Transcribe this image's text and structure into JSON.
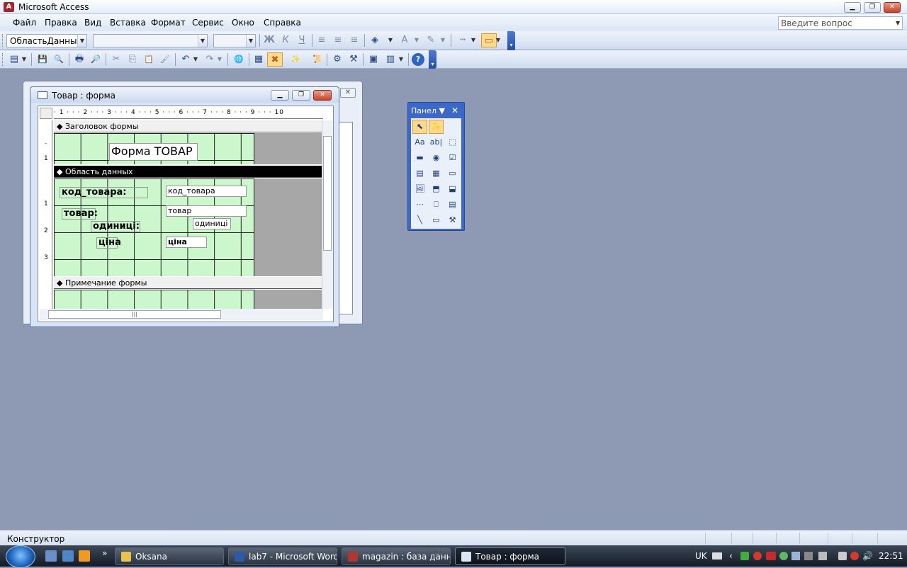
{
  "app": {
    "title": "Microsoft Access",
    "icon_letter": "A"
  },
  "window_controls": {
    "minimize": "▁",
    "restore": "❐",
    "close": "✕"
  },
  "menu": [
    "Файл",
    "Правка",
    "Вид",
    "Вставка",
    "Формат",
    "Сервис",
    "Окно",
    "Справка"
  ],
  "help_search_placeholder": "Введите вопрос",
  "formatting_toolbar": {
    "object_combo": "ОбластьДанных",
    "font_combo": "",
    "size_combo": "",
    "bold": "Ж",
    "italic": "К",
    "underline": "Ч",
    "align_left_icon": "≡",
    "align_center_icon": "≡",
    "align_right_icon": "≡",
    "fill_color_icon": "◈",
    "font_color_icon": "A",
    "line_color_icon": "✎",
    "line_width_icon": "┅",
    "special_effect_icon": "▭"
  },
  "design_toolbar": {
    "view_icon": "▤",
    "save_icon": "💾",
    "search_icon": "🔍",
    "print_icon": "🖶",
    "preview_icon": "🔎",
    "cut_icon": "✂",
    "copy_icon": "⎘",
    "paste_icon": "📋",
    "format_painter_icon": "🖌",
    "undo_icon": "↶",
    "redo_icon": "↷",
    "hyperlink_icon": "🌐",
    "field_list_icon": "▦",
    "toolbox_icon": "✖",
    "autoformat_icon": "✨",
    "code_icon": "📜",
    "properties_icon": "⚙",
    "build_icon": "⚒",
    "database_window_icon": "▣",
    "new_object_icon": "▥",
    "help_icon": "?"
  },
  "form_window": {
    "title": "Товар : форма",
    "ruler_marks": "· 1 · · · 2 · · · 3 · · · 4 · · · 5 · · · 6 · · · 7 · · · 8 · · · 9 · · · 10",
    "sections": {
      "header": "Заголовок формы",
      "detail": "Область данных",
      "footer": "Примечание формы"
    },
    "header_label": "Форма ТОВАР",
    "labels": {
      "kod": "код_товара:",
      "tovar": "товар:",
      "odinici": "одиниці:",
      "cina": "ціна"
    },
    "fields": {
      "kod": "код_товара",
      "tovar": "товар",
      "odinici": "одиниці",
      "cina": "ціна"
    },
    "vruler": {
      "one": "1",
      "one_b": "1",
      "two": "2",
      "three": "3"
    }
  },
  "toolbox": {
    "title": "Панел",
    "dropdown_icon": "▼",
    "close_icon": "✕",
    "tools": [
      {
        "name": "select-objects",
        "glyph": "⬉"
      },
      {
        "name": "control-wizards",
        "glyph": "✨"
      },
      {
        "name": "blank",
        "glyph": ""
      },
      {
        "name": "label",
        "glyph": "Aa"
      },
      {
        "name": "text-box",
        "glyph": "ab|"
      },
      {
        "name": "option-group",
        "glyph": "⬚"
      },
      {
        "name": "toggle-button",
        "glyph": "▬"
      },
      {
        "name": "option-button",
        "glyph": "◉"
      },
      {
        "name": "check-box",
        "glyph": "☑"
      },
      {
        "name": "combo-box",
        "glyph": "▤"
      },
      {
        "name": "list-box",
        "glyph": "▦"
      },
      {
        "name": "command-button",
        "glyph": "▭"
      },
      {
        "name": "image",
        "glyph": "🖼"
      },
      {
        "name": "unbound-object-frame",
        "glyph": "⬒"
      },
      {
        "name": "bound-object-frame",
        "glyph": "⬓"
      },
      {
        "name": "page-break",
        "glyph": "⋯"
      },
      {
        "name": "tab-control",
        "glyph": "⎕"
      },
      {
        "name": "subform",
        "glyph": "▤"
      },
      {
        "name": "line",
        "glyph": "╲"
      },
      {
        "name": "rectangle",
        "glyph": "▭"
      },
      {
        "name": "more-controls",
        "glyph": "⚒"
      }
    ]
  },
  "status": {
    "text": "Конструктор"
  },
  "taskbar": {
    "tasks": [
      {
        "label": "Oksana",
        "color": "#e8c24a"
      },
      {
        "label": "lab7 - Microsoft Word",
        "color": "#2b5aa8"
      },
      {
        "label": "magazin : база данн...",
        "color": "#b0372f"
      },
      {
        "label": "Товар : форма",
        "color": "#d9e4f4"
      }
    ],
    "more": "»",
    "lang": "UK",
    "clock": "22:51"
  }
}
